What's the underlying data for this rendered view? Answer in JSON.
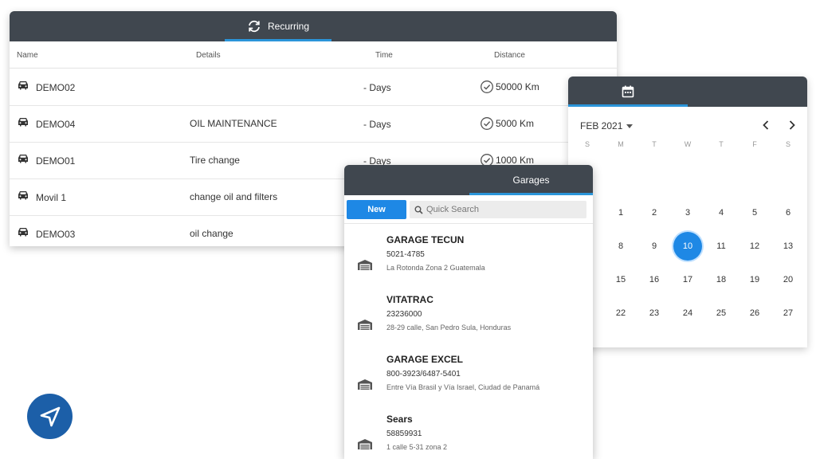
{
  "recurring": {
    "tab_label": "Recurring",
    "columns": {
      "name": "Name",
      "details": "Details",
      "time": "Time",
      "distance": "Distance"
    },
    "rows": [
      {
        "name": "DEMO02",
        "details": "",
        "time": "- Days",
        "distance": "50000 Km"
      },
      {
        "name": "DEMO04",
        "details": "OIL MAINTENANCE",
        "time": "- Days",
        "distance": "5000 Km"
      },
      {
        "name": "DEMO01",
        "details": "Tire change",
        "time": "- Days",
        "distance": "1000 Km"
      },
      {
        "name": "Movil 1",
        "details": "change oil and filters",
        "time": "",
        "distance": ""
      },
      {
        "name": "DEMO03",
        "details": "oil change",
        "time": "",
        "distance": ""
      }
    ]
  },
  "calendar": {
    "month_label": "FEB 2021",
    "weekdays": [
      "S",
      "M",
      "T",
      "W",
      "T",
      "F",
      "S"
    ],
    "days": [
      "1",
      "2",
      "3",
      "4",
      "5",
      "6",
      "8",
      "9",
      "10",
      "11",
      "12",
      "13",
      "15",
      "16",
      "17",
      "18",
      "19",
      "20",
      "22",
      "23",
      "24",
      "25",
      "26",
      "27"
    ],
    "selected_day": "10"
  },
  "garages": {
    "tab_label": "Garages",
    "new_label": "New",
    "search_placeholder": "Quick Search",
    "items": [
      {
        "name": "GARAGE TECUN",
        "phone": "5021-4785",
        "address": "La Rotonda Zona 2 Guatemala"
      },
      {
        "name": "VITATRAC",
        "phone": "23236000",
        "address": "28-29 calle, San Pedro Sula, Honduras"
      },
      {
        "name": "GARAGE EXCEL",
        "phone": "800-3923/6487-5401",
        "address": "Entre Vía Brasil y Vía Israel, Ciudad de Panamá"
      },
      {
        "name": "Sears",
        "phone": "58859931",
        "address": "1 calle 5-31 zona 2"
      }
    ]
  },
  "icons": {
    "recurring_tab": "sync-icon",
    "vehicle": "car-icon",
    "distance": "check-circle-icon",
    "calendar_tab": "calendar-icon",
    "prev": "chevron-left-icon",
    "next": "chevron-right-icon",
    "search": "search-icon",
    "garage": "garage-icon",
    "logo": "navigation-arrow-icon"
  },
  "colors": {
    "header_bg": "#40474f",
    "tab_underline": "#2b95d9",
    "primary_button": "#1e88e5",
    "logo_bg": "#1c5fa8"
  }
}
